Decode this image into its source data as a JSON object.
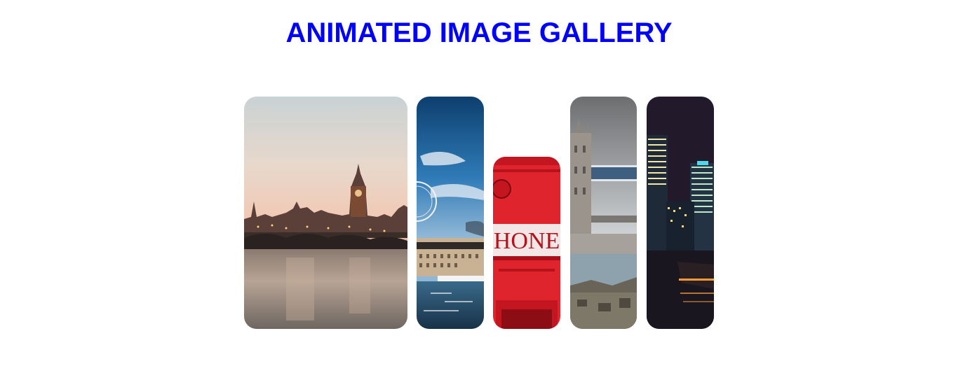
{
  "header": {
    "title": "ANIMATED IMAGE GALLERY",
    "title_color": "#0000ff"
  },
  "gallery": {
    "items": [
      {
        "icon": "big-ben-parliament-photo"
      },
      {
        "icon": "london-eye-thames-photo"
      },
      {
        "icon": "red-telephone-box-photo",
        "sign_text": "HONE"
      },
      {
        "icon": "tower-bridge-photo"
      },
      {
        "icon": "canary-wharf-night-photo"
      }
    ]
  }
}
